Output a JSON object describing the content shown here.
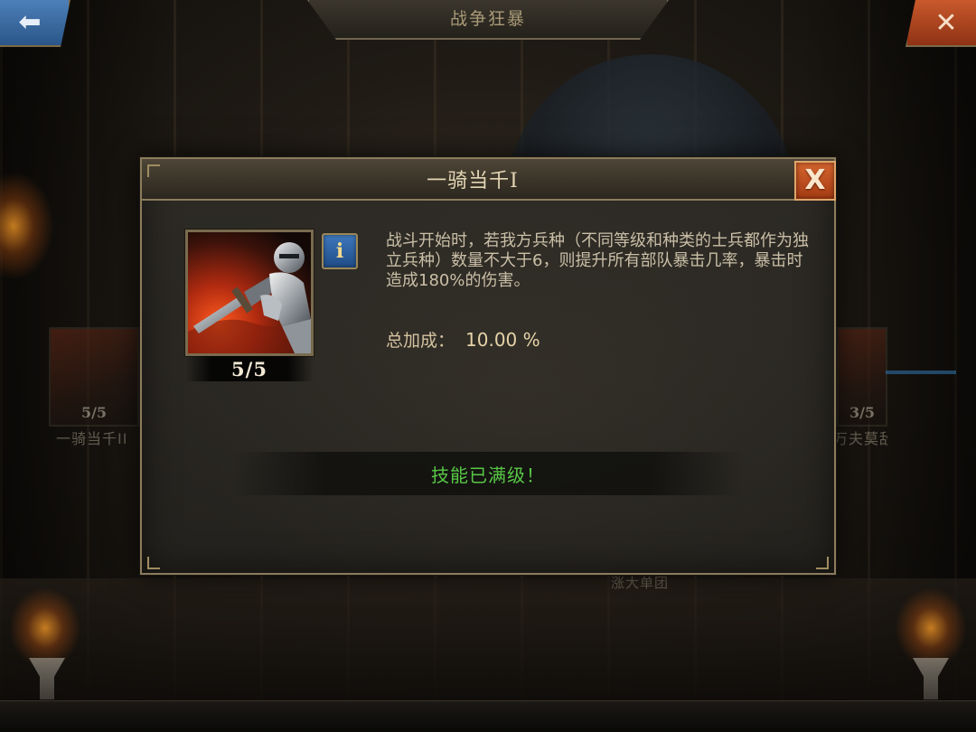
{
  "top_bar": {
    "title": "战争狂暴",
    "back_icon": "back-arrow-icon",
    "close_icon": "close-icon"
  },
  "background": {
    "left_tile": {
      "level": "5/5",
      "name": "一骑当千II"
    },
    "right_tile": {
      "level": "3/5",
      "name": "万夫莫敌III"
    },
    "label": "涨大单团"
  },
  "dialog": {
    "title": "一骑当千I",
    "close_glyph": "X",
    "skill": {
      "icon": "knight-sword-icon",
      "level": "5/5",
      "info_glyph": "i",
      "description": "战斗开始时，若我方兵种（不同等级和种类的士兵都作为独立兵种）数量不大于6，则提升所有部队暴击几率，暴击时造成180%的伤害。",
      "bonus_label": "总加成：",
      "bonus_value": "10.00 %"
    },
    "status": "技能已满级！"
  },
  "colors": {
    "status_green": "#58c846",
    "close_orange": "#d6652e",
    "info_blue": "#3e78bd",
    "frame_gold": "#8c7c5c"
  }
}
